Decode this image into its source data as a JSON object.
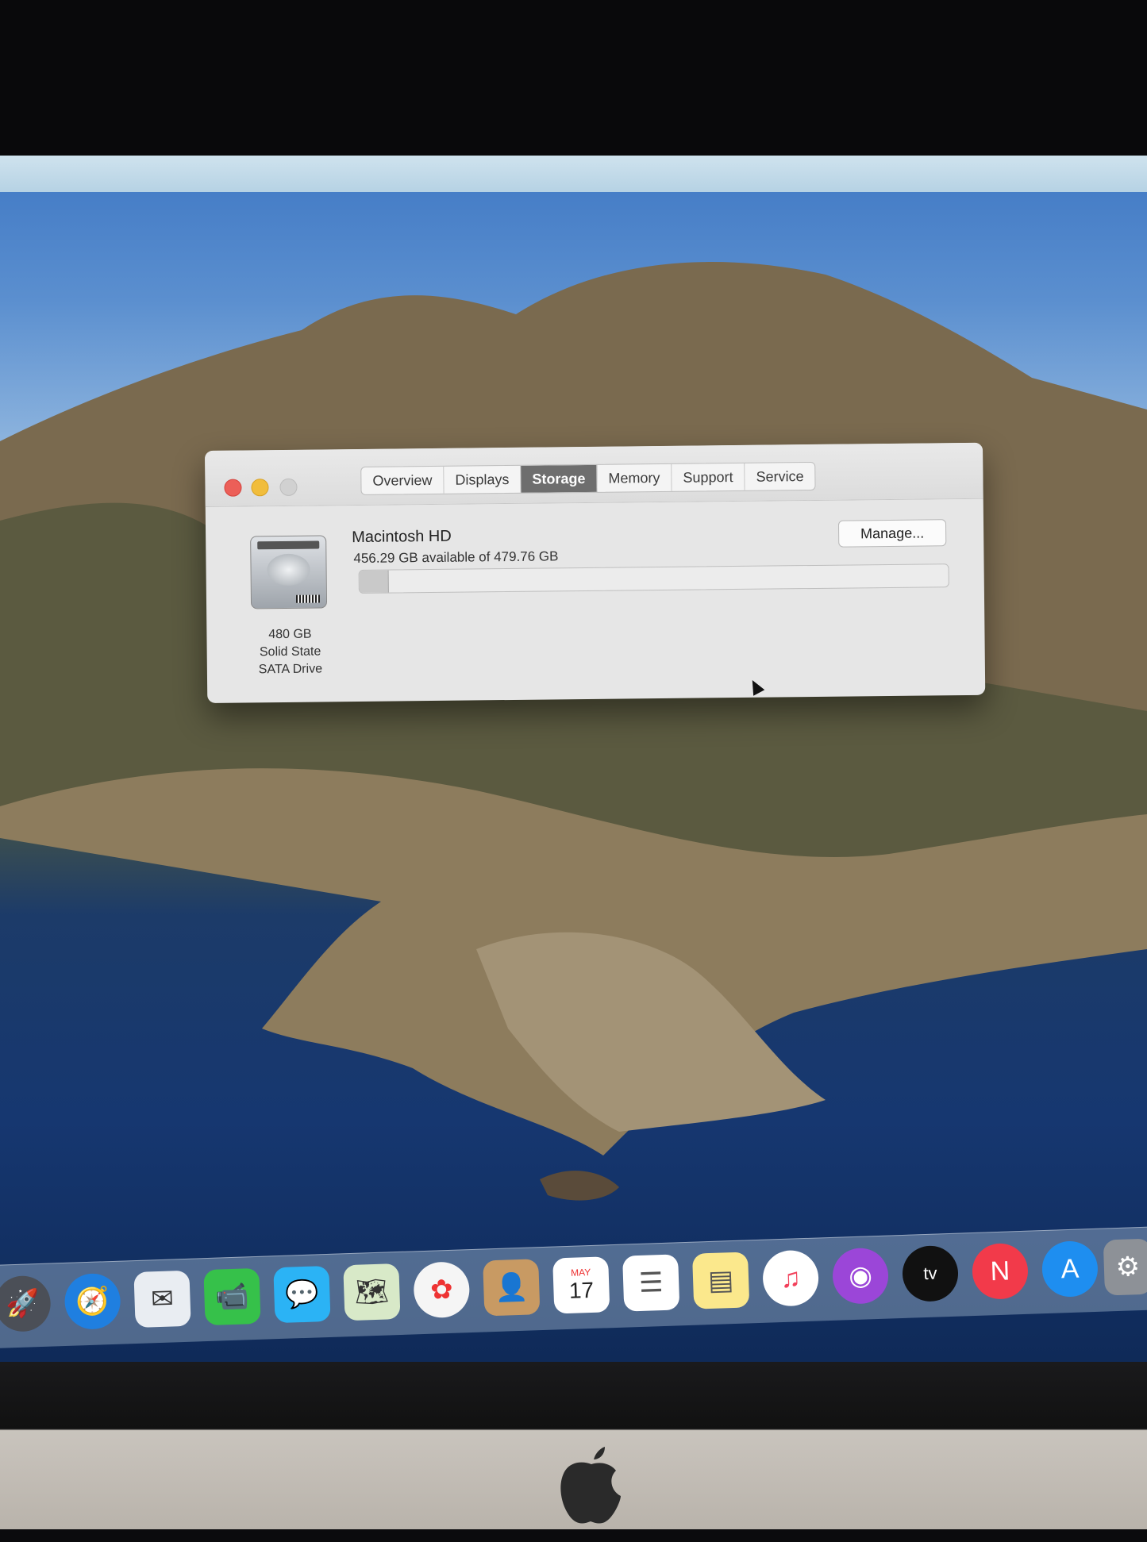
{
  "window": {
    "tabs": [
      "Overview",
      "Displays",
      "Storage",
      "Memory",
      "Support",
      "Service"
    ],
    "active_tab": "Storage"
  },
  "storage": {
    "drive_capacity": "480 GB",
    "drive_type_line1": "Solid State",
    "drive_type_line2": "SATA Drive",
    "volume_name": "Macintosh HD",
    "availability_text": "456.29 GB available of 479.76 GB",
    "used_fraction": 0.049,
    "manage_label": "Manage..."
  },
  "dock": {
    "calendar_month": "MAY",
    "calendar_day": "17",
    "tv_label": "tv",
    "apps": [
      "launchpad-icon",
      "safari-icon",
      "mail-icon",
      "facetime-icon",
      "messages-icon",
      "maps-icon",
      "photos-icon",
      "contacts-icon",
      "calendar-icon",
      "reminders-icon",
      "notes-icon",
      "music-icon",
      "podcasts-icon",
      "tv-icon",
      "news-icon",
      "app-store-icon",
      "system-preferences-icon"
    ]
  },
  "colors": {
    "close": "#ec5f58",
    "minimize": "#f1bd3c",
    "zoom": "#d1d1d1",
    "active_tab": "#6e6e6e"
  }
}
